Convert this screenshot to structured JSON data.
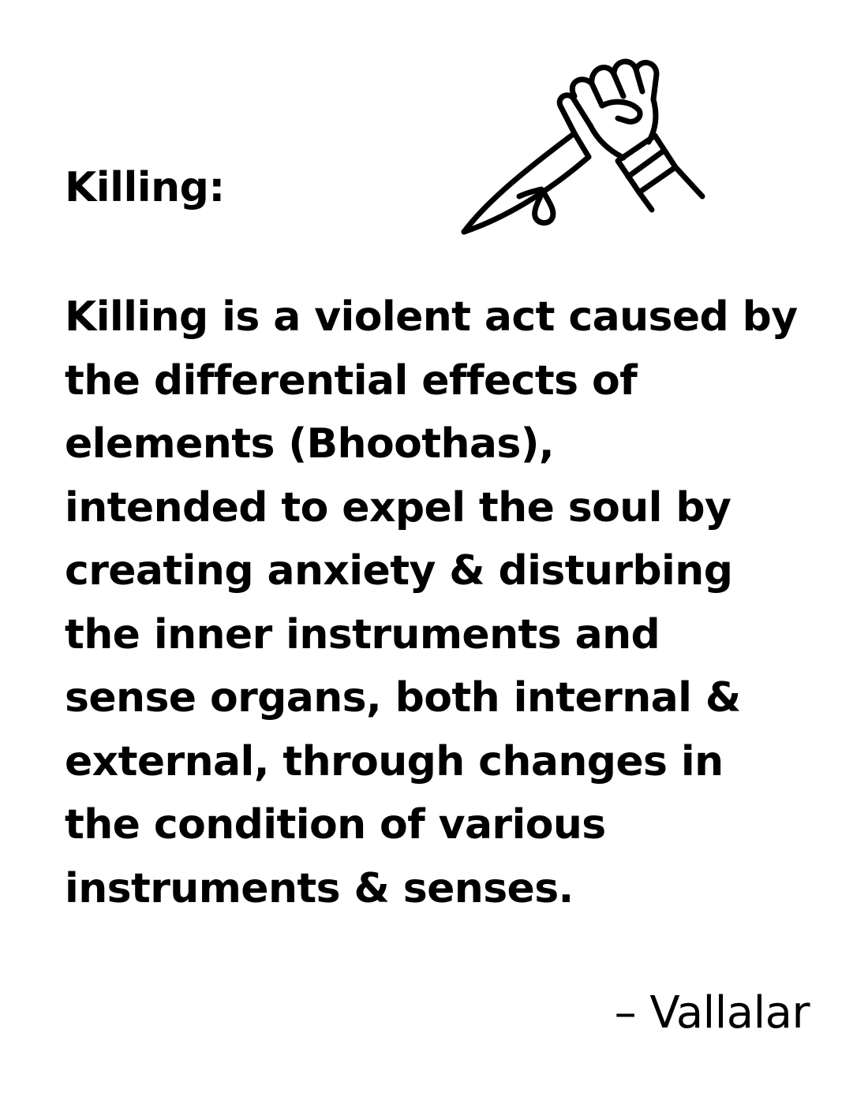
{
  "heading": "Killing:",
  "icon": "hand-holding-bloody-knife-icon",
  "body_lines": [
    "Killing is a violent act caused by",
    "the differential effects of",
    "elements (Bhoothas),",
    "intended to expel the soul by",
    "creating anxiety & disturbing",
    "the inner instruments and",
    "sense organs, both internal &",
    "external, through changes in",
    "the condition of various",
    "instruments & senses."
  ],
  "attribution": "– Vallalar",
  "colors": {
    "text": "#000000",
    "background": "#ffffff"
  }
}
